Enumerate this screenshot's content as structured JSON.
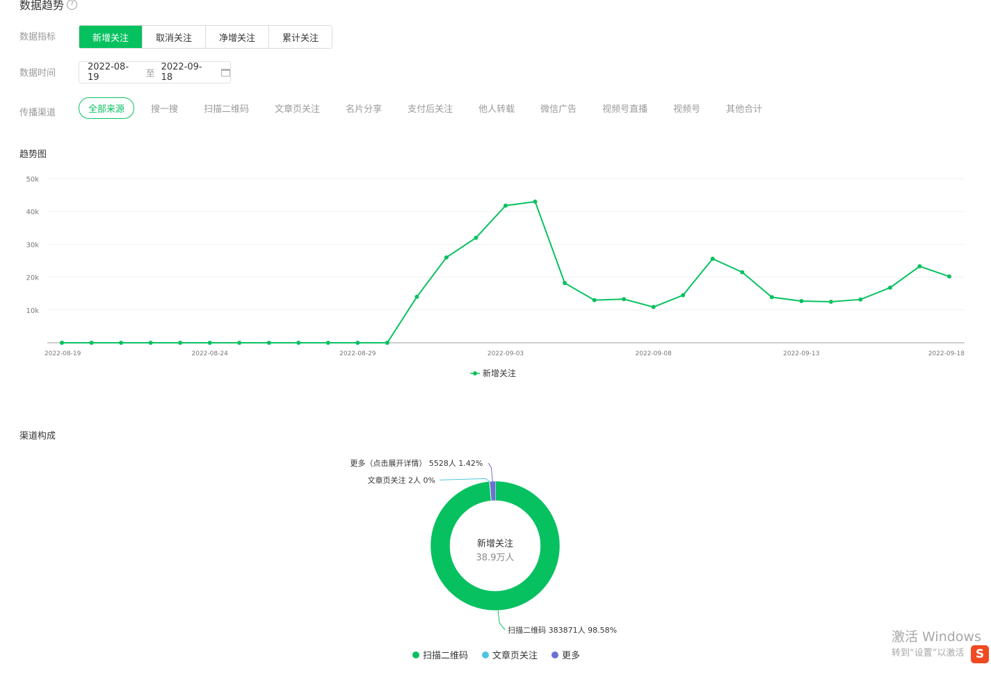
{
  "header": {
    "title": "数据趋势",
    "help_icon": "?"
  },
  "filters": {
    "metric_label": "数据指标",
    "metrics": [
      "新增关注",
      "取消关注",
      "净增关注",
      "累计关注"
    ],
    "time_label": "数据时间",
    "date_start": "2022-08-19",
    "date_sep": "至",
    "date_end": "2022-09-18",
    "channel_label": "传播渠道",
    "channels": [
      "全部来源",
      "搜一搜",
      "扫描二维码",
      "文章页关注",
      "名片分享",
      "支付后关注",
      "他人转载",
      "微信广告",
      "视频号直播",
      "视频号",
      "其他合计"
    ]
  },
  "trend": {
    "title": "趋势图"
  },
  "composition": {
    "title": "渠道构成",
    "center_label": "新增关注",
    "center_value": "38.9万人"
  },
  "colors": {
    "accent": "#07c160",
    "light_blue": "#4cc6e0",
    "purple": "#6c6fd4"
  },
  "watermark": {
    "line1": "激活 Windows",
    "line2": "转到“设置”以激活",
    "icon": "S"
  },
  "chart_data": [
    {
      "type": "line",
      "ylim": [
        0,
        50000
      ],
      "y_ticks": [
        "10k",
        "20k",
        "30k",
        "40k",
        "50k"
      ],
      "x_tick_labels": [
        "2022-08-19",
        "2022-08-24",
        "2022-08-29",
        "2022-09-03",
        "2022-09-08",
        "2022-09-13",
        "2022-09-18"
      ],
      "x": [
        "2022-08-19",
        "2022-08-20",
        "2022-08-21",
        "2022-08-22",
        "2022-08-23",
        "2022-08-24",
        "2022-08-25",
        "2022-08-26",
        "2022-08-27",
        "2022-08-28",
        "2022-08-29",
        "2022-08-30",
        "2022-08-31",
        "2022-09-01",
        "2022-09-02",
        "2022-09-03",
        "2022-09-04",
        "2022-09-05",
        "2022-09-06",
        "2022-09-07",
        "2022-09-08",
        "2022-09-09",
        "2022-09-10",
        "2022-09-11",
        "2022-09-12",
        "2022-09-13",
        "2022-09-14",
        "2022-09-15",
        "2022-09-16",
        "2022-09-17",
        "2022-09-18"
      ],
      "series": [
        {
          "name": "新增关注",
          "color": "#07c160",
          "values": [
            0,
            0,
            0,
            0,
            0,
            0,
            0,
            0,
            0,
            0,
            0,
            0,
            14000,
            26000,
            32000,
            41800,
            43000,
            18200,
            13000,
            13300,
            10900,
            14500,
            25600,
            21500,
            13900,
            12700,
            12500,
            13200,
            16800,
            23300,
            20200
          ]
        }
      ],
      "grid": true,
      "legend": "bottom-center"
    },
    {
      "type": "pie",
      "slices": [
        {
          "name": "扫描二维码",
          "label": "扫描二维码 383871人 98.58%",
          "value": 383871,
          "percent": 98.58,
          "color": "#07c160"
        },
        {
          "name": "文章页关注",
          "label": "文章页关注 2人 0%",
          "value": 2,
          "percent": 0,
          "color": "#4cc6e0"
        },
        {
          "name": "更多",
          "label": "更多（点击展开详情） 5528人 1.42%",
          "value": 5528,
          "percent": 1.42,
          "color": "#6c6fd4"
        }
      ],
      "legend": "bottom-center"
    }
  ]
}
